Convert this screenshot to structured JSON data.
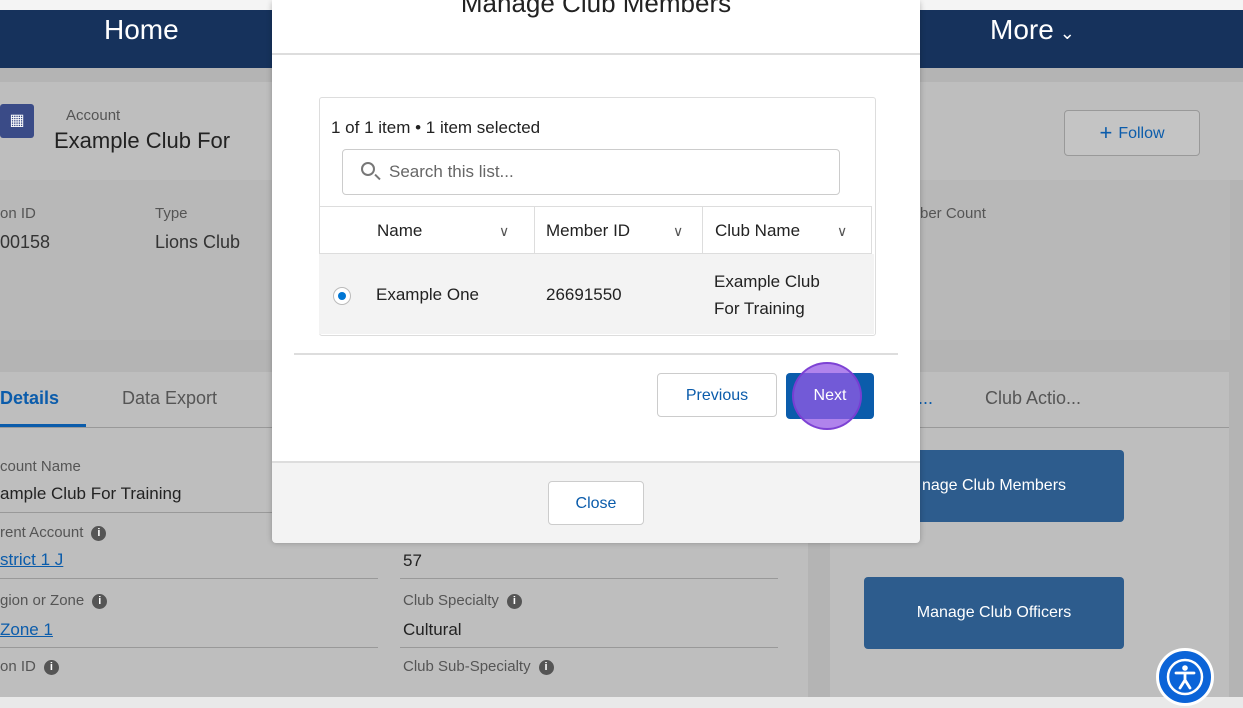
{
  "nav": {
    "home": "Home",
    "more": "More"
  },
  "account": {
    "object_label": "Account",
    "name": "Example Club For ",
    "follow_label": "Follow"
  },
  "highlights": {
    "id_label": "on ID",
    "id_value": "00158",
    "type_label": "Type",
    "type_value": "Lions Club",
    "count_label": "ber Count"
  },
  "tabs_left": [
    "Details",
    "Data Export"
  ],
  "tabs_right": [
    "...",
    "Club Actio..."
  ],
  "details": {
    "account_name_label": "count Name",
    "account_name_value": "ample Club For Training",
    "parent_label": "rent Account",
    "parent_value": "strict 1 J",
    "region_label": "gion or Zone",
    "region_value": "Zone 1",
    "id_label": "on ID",
    "right_value_top": "57",
    "specialty_label": "Club Specialty",
    "specialty_value": "Cultural",
    "subspecialty_label": "Club Sub-Specialty"
  },
  "actions": {
    "manage_members": "nage Club Members",
    "manage_officers": "Manage Club Officers"
  },
  "modal": {
    "title": "Manage Club Members",
    "count_text": "1 of 1 item • 1 item selected",
    "search_placeholder": "Search this list...",
    "columns": [
      "Name",
      "Member ID",
      "Club Name"
    ],
    "row": {
      "name": "Example One",
      "member_id": "26691550",
      "club_line1": "Example Club",
      "club_line2": "For Training"
    },
    "previous": "Previous",
    "next": "Next",
    "close": "Close"
  }
}
